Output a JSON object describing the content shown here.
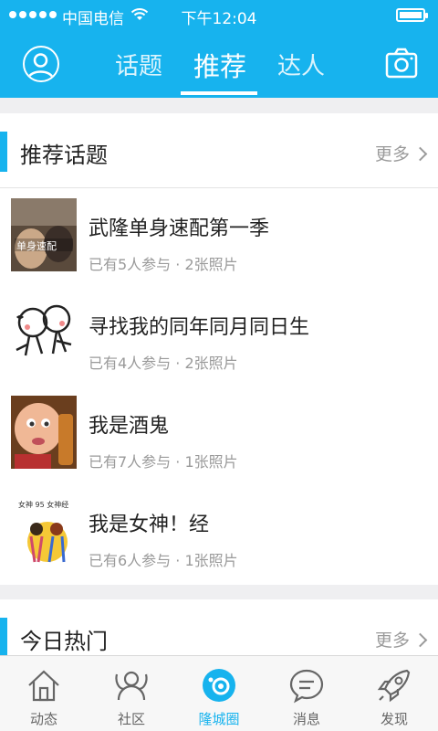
{
  "status_bar": {
    "carrier": "中国电信",
    "time": "下午12:04"
  },
  "header": {
    "tabs": [
      {
        "label": "话题",
        "active": false
      },
      {
        "label": "推荐",
        "active": true
      },
      {
        "label": "达人",
        "active": false
      }
    ],
    "left_icon": "avatar-icon",
    "right_icon": "camera-icon"
  },
  "recommended": {
    "title": "推荐话题",
    "more_label": "更多",
    "items": [
      {
        "name": "武隆单身速配第一季",
        "meta": "已有5人参与 · 2张照片"
      },
      {
        "name": "寻找我的同年同月同日生",
        "meta": "已有4人参与 · 2张照片"
      },
      {
        "name": "我是酒鬼",
        "meta": "已有7人参与 · 1张照片"
      },
      {
        "name": "我是女神！经",
        "meta": "已有6人参与 · 1张照片"
      }
    ]
  },
  "hot_today": {
    "title": "今日热门",
    "more_label": "更多"
  },
  "bottom_nav": {
    "items": [
      {
        "label": "动态",
        "icon": "home-icon",
        "active": false
      },
      {
        "label": "社区",
        "icon": "community-icon",
        "active": false
      },
      {
        "label": "隆城圈",
        "icon": "circle-camera-icon",
        "active": true
      },
      {
        "label": "消息",
        "icon": "message-icon",
        "active": false
      },
      {
        "label": "发现",
        "icon": "rocket-icon",
        "active": false
      }
    ]
  },
  "colors": {
    "accent": "#17b3ee",
    "background": "#efeff1",
    "muted_text": "#9a9a9a"
  }
}
